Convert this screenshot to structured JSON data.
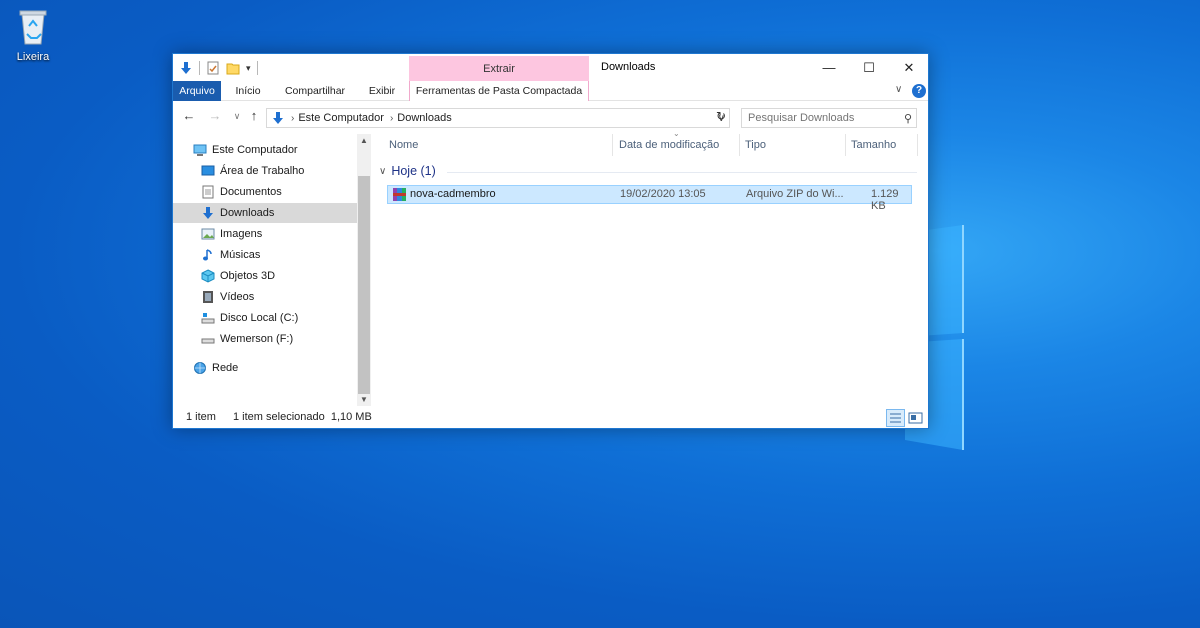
{
  "desktop": {
    "recycle_bin_label": "Lixeira"
  },
  "window": {
    "title": "Downloads",
    "contextual_tab_group": "Extrair",
    "controls": {
      "minimize": "—",
      "maximize": "☐",
      "close": "✕"
    }
  },
  "ribbon": {
    "tabs": [
      {
        "label": "Arquivo"
      },
      {
        "label": "Início"
      },
      {
        "label": "Compartilhar"
      },
      {
        "label": "Exibir"
      },
      {
        "label": "Ferramentas de Pasta Compactada"
      }
    ],
    "help_label": "?"
  },
  "address": {
    "crumbs": [
      "Este Computador",
      "Downloads"
    ],
    "search_placeholder": "Pesquisar Downloads"
  },
  "nav": {
    "items": [
      {
        "label": "Este Computador",
        "icon": "pc-icon"
      },
      {
        "label": "Área de Trabalho",
        "icon": "desktop-icon"
      },
      {
        "label": "Documentos",
        "icon": "documents-icon"
      },
      {
        "label": "Downloads",
        "icon": "downloads-icon",
        "selected": true
      },
      {
        "label": "Imagens",
        "icon": "pictures-icon"
      },
      {
        "label": "Músicas",
        "icon": "music-icon"
      },
      {
        "label": "Objetos 3D",
        "icon": "3d-objects-icon"
      },
      {
        "label": "Vídeos",
        "icon": "videos-icon"
      },
      {
        "label": "Disco Local (C:)",
        "icon": "drive-icon"
      },
      {
        "label": "Wemerson (F:)",
        "icon": "usb-drive-icon"
      },
      {
        "label": "Rede",
        "icon": "network-icon"
      }
    ]
  },
  "files": {
    "columns": [
      "Nome",
      "Data de modificação",
      "Tipo",
      "Tamanho"
    ],
    "group_label": "Hoje (1)",
    "rows": [
      {
        "name": "nova-cadmembro",
        "modified": "19/02/2020 13:05",
        "type": "Arquivo ZIP do Wi...",
        "size": "1.129 KB"
      }
    ]
  },
  "status": {
    "count": "1 item",
    "selection": "1 item selecionado  1,10 MB"
  },
  "colors": {
    "accent": "#1a5cae",
    "selection": "#cce8ff",
    "contextual_tab": "#fdc6e0"
  }
}
